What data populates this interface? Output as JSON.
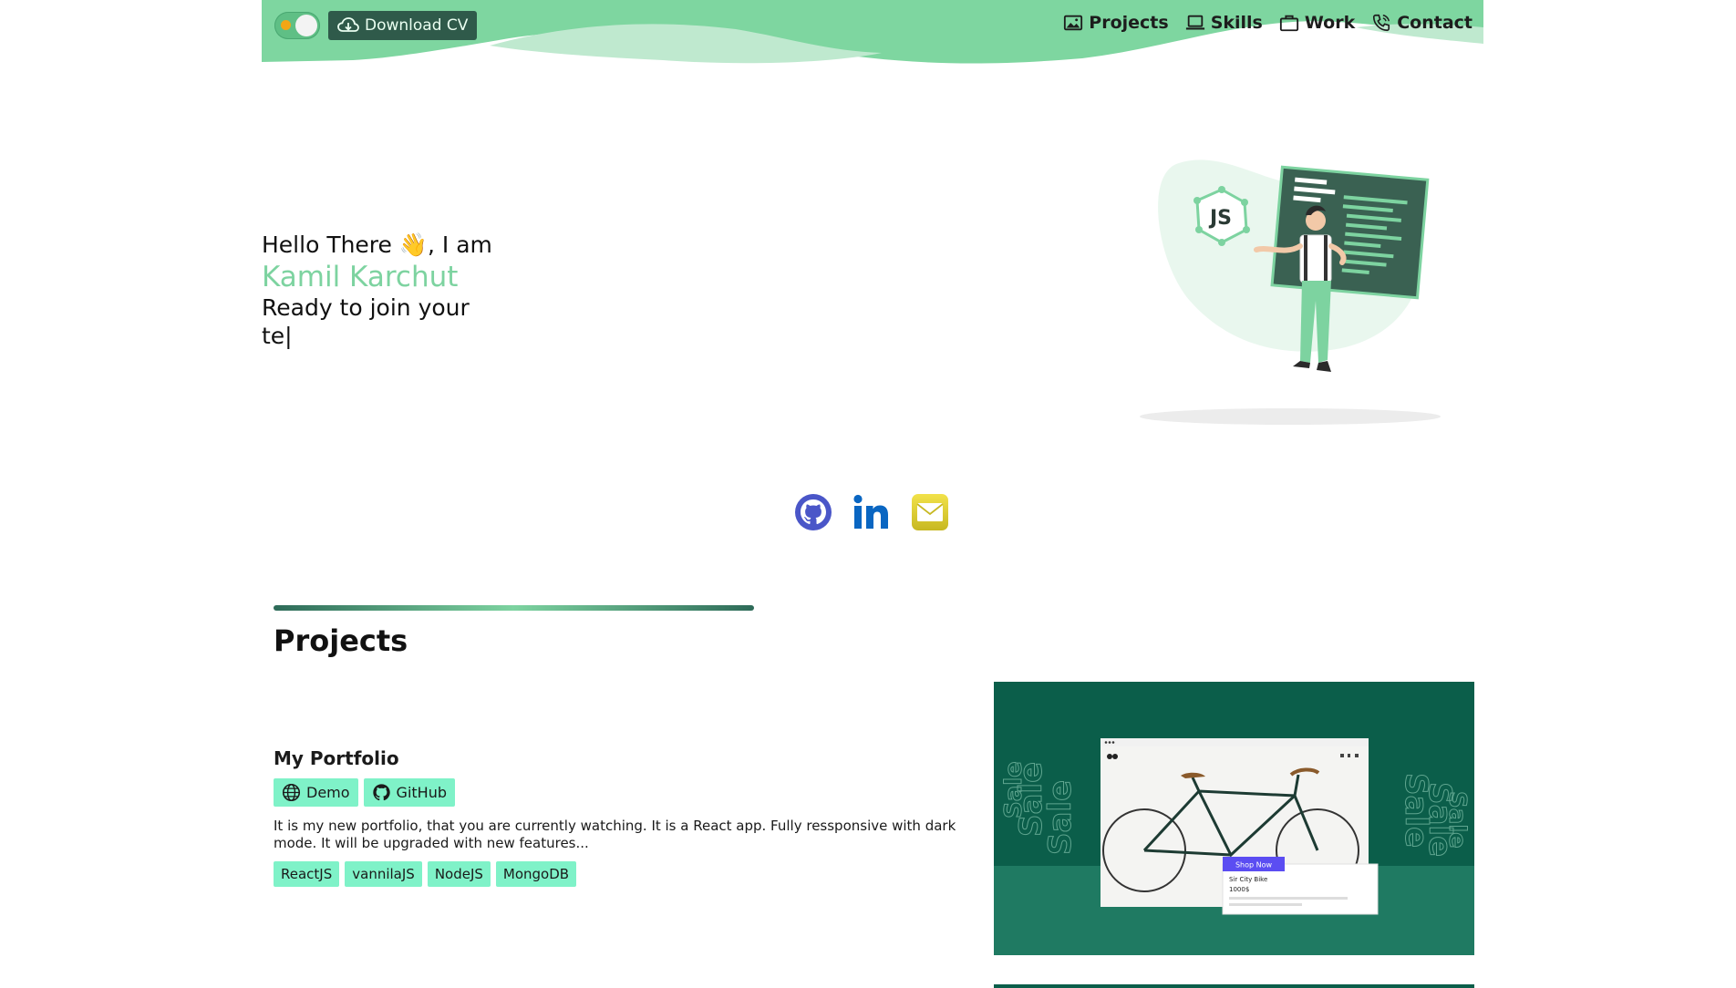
{
  "header": {
    "download_label": "Download CV",
    "nav": [
      {
        "label": "Projects",
        "icon": "image-icon"
      },
      {
        "label": "Skills",
        "icon": "laptop-icon"
      },
      {
        "label": "Work",
        "icon": "briefcase-icon"
      },
      {
        "label": "Contact",
        "icon": "phone-icon"
      }
    ]
  },
  "hero": {
    "greeting": "Hello There 👋, I am",
    "name": "Kamil Karchut",
    "typed": "Ready to join your te|",
    "illustration_text": "JS"
  },
  "socials": [
    "github-icon",
    "linkedin-icon",
    "email-icon"
  ],
  "projects": {
    "title": "Projects",
    "items": [
      {
        "name": "My Portfolio",
        "links": [
          {
            "label": "Demo",
            "icon": "globe-icon"
          },
          {
            "label": "GitHub",
            "icon": "github-icon"
          }
        ],
        "description": "It is my new portfolio, that you are currently watching. It is a React app. Fully ressponsive with dark mode. It will be upgraded with new features...",
        "tags": [
          "ReactJS",
          "vannilaJS",
          "NodeJS",
          "MongoDB"
        ],
        "preview": {
          "sale_word": "Sale",
          "button": "Shop Now",
          "product": "Sir City Bike",
          "price": "1000$"
        }
      }
    ]
  },
  "colors": {
    "accent": "#7dd3a0",
    "header_green": "#7ed6a0",
    "dark_green": "#2f5a4a",
    "tag_bg": "#7ff2c8",
    "preview_bg": "#0b5e4a"
  }
}
